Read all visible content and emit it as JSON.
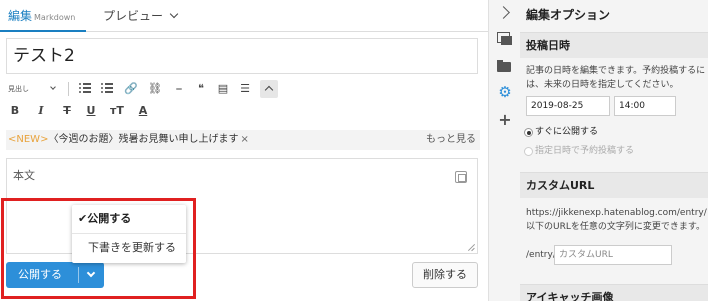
{
  "tabs": {
    "edit_label": "編集",
    "edit_sub": "Markdown",
    "preview_label": "プレビュー"
  },
  "editor": {
    "title_value": "テスト2",
    "body_placeholder": "本文"
  },
  "toolbar": {
    "heading_select": "見出し",
    "bold": "B",
    "italic": "I",
    "strike": "T",
    "underline": "U",
    "text_size": "тT",
    "text_color": "A"
  },
  "notice": {
    "new_tag": "<NEW>",
    "message": "〈今週のお題〉残暑お見舞い申し上げます",
    "close": "×",
    "more": "もっと見る"
  },
  "buttons": {
    "publish": "公開する",
    "delete": "削除する"
  },
  "dropdown": {
    "item1": "✔公開する",
    "item2": "下書きを更新する"
  },
  "sidebar": {
    "title": "編集オプション",
    "date_section": "投稿日時",
    "date_desc": "記事の日時を編集できます。予約投稿するには、未来の日時を指定してください。",
    "date_value": "2019-08-25",
    "time_value": "14:00",
    "radio_now": "すぐに公開する",
    "radio_scheduled": "指定日時で予約投稿する",
    "url_section": "カスタムURL",
    "url_desc": "https://jikkenexp.hatenablog.com/entry/以下のURLを任意の文字列に変更できます。",
    "url_prefix": "/entry/",
    "url_placeholder": "カスタムURL",
    "eyecatch_section": "アイキャッチ画像"
  },
  "colors": {
    "accent": "#2d8fd9",
    "highlight": "#e02020",
    "new_tag": "#e8a33d"
  }
}
